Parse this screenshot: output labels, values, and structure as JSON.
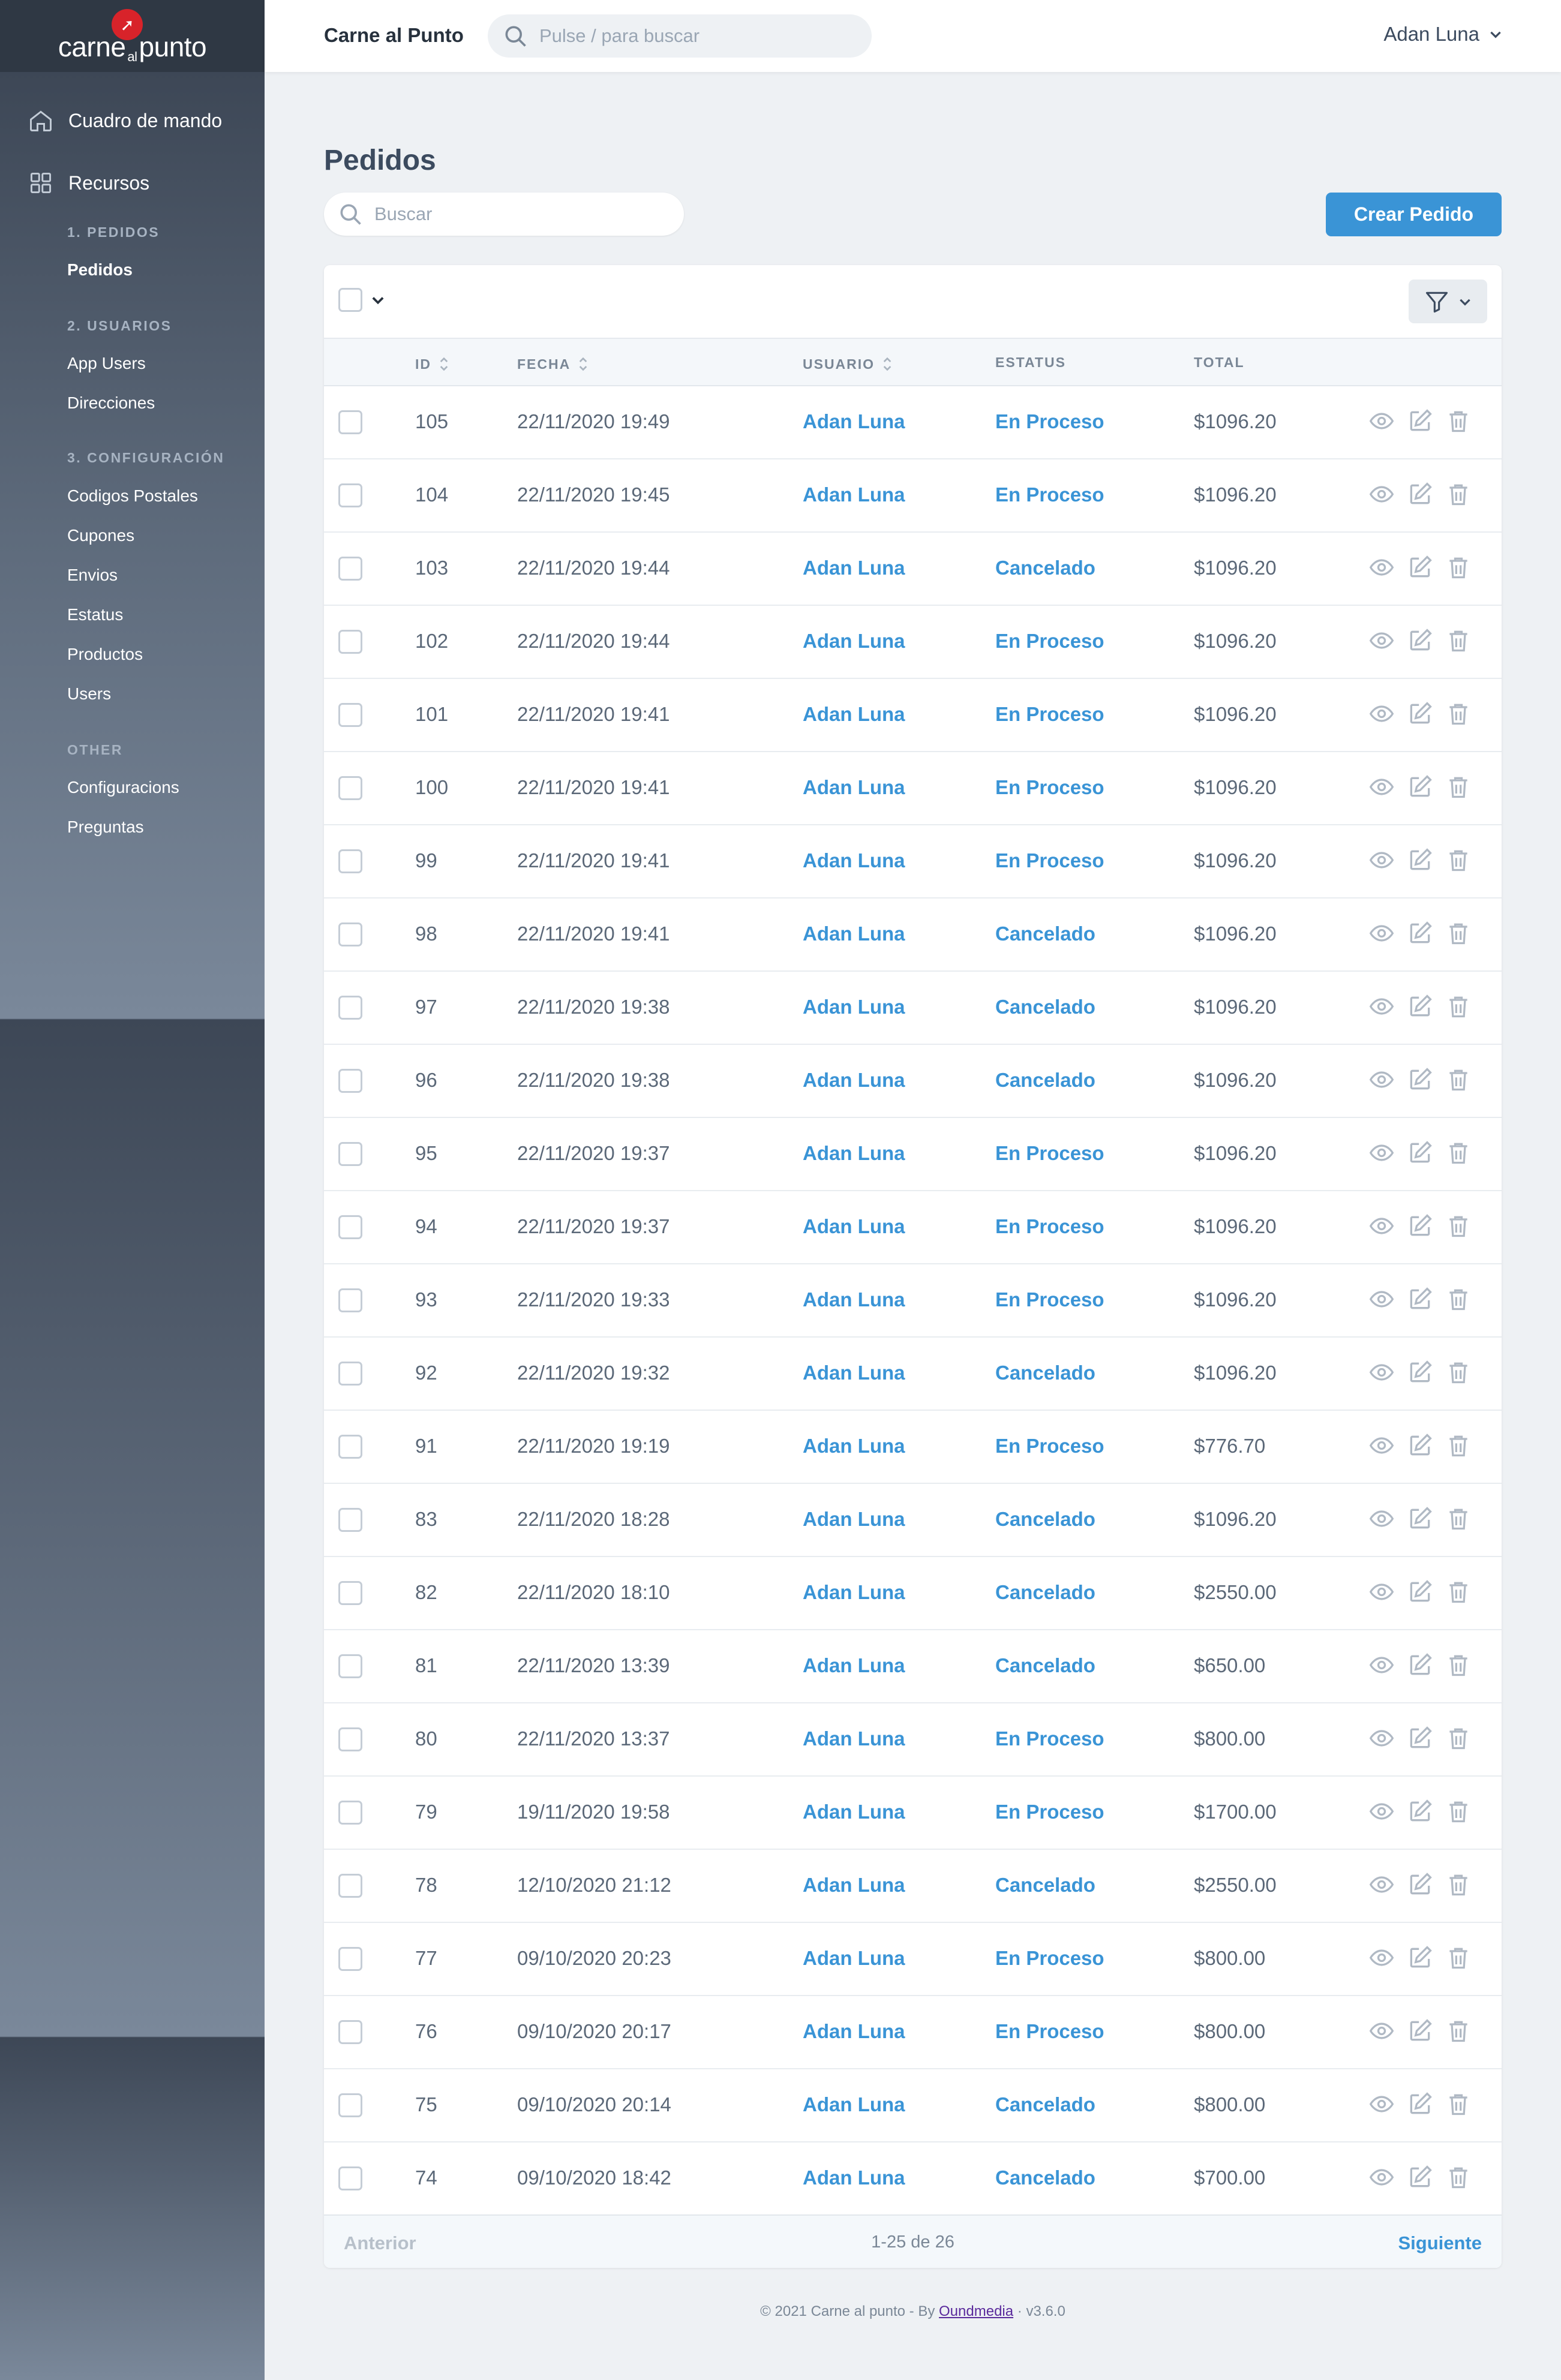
{
  "sidebar": {
    "logo": {
      "left": "carne",
      "middle": "al",
      "right": "punto"
    },
    "main_items": [
      {
        "label": "Cuadro de mando",
        "icon": "home-icon"
      },
      {
        "label": "Recursos",
        "icon": "grid-icon"
      }
    ],
    "sections": [
      {
        "title": "1. PEDIDOS",
        "items": [
          "Pedidos"
        ]
      },
      {
        "title": "2. USUARIOS",
        "items": [
          "App Users",
          "Direcciones"
        ]
      },
      {
        "title": "3. CONFIGURACIÓN",
        "items": [
          "Codigos Postales",
          "Cupones",
          "Envios",
          "Estatus",
          "Productos",
          "Users"
        ]
      },
      {
        "title": "OTHER",
        "items": [
          "Configuracions",
          "Preguntas"
        ]
      }
    ],
    "active_item": "Pedidos"
  },
  "header": {
    "brand": "Carne al Punto",
    "search_placeholder": "Pulse / para buscar",
    "user_name": "Adan Luna"
  },
  "main": {
    "title": "Pedidos",
    "search_placeholder": "Buscar",
    "create_button": "Crear Pedido"
  },
  "table": {
    "columns": [
      "ID",
      "FECHA",
      "USUARIO",
      "ESTATUS",
      "TOTAL"
    ],
    "rows": [
      {
        "id": "105",
        "fecha": "22/11/2020 19:49",
        "usuario": "Adan Luna",
        "estatus": "En Proceso",
        "total": "$1096.20"
      },
      {
        "id": "104",
        "fecha": "22/11/2020 19:45",
        "usuario": "Adan Luna",
        "estatus": "En Proceso",
        "total": "$1096.20"
      },
      {
        "id": "103",
        "fecha": "22/11/2020 19:44",
        "usuario": "Adan Luna",
        "estatus": "Cancelado",
        "total": "$1096.20"
      },
      {
        "id": "102",
        "fecha": "22/11/2020 19:44",
        "usuario": "Adan Luna",
        "estatus": "En Proceso",
        "total": "$1096.20"
      },
      {
        "id": "101",
        "fecha": "22/11/2020 19:41",
        "usuario": "Adan Luna",
        "estatus": "En Proceso",
        "total": "$1096.20"
      },
      {
        "id": "100",
        "fecha": "22/11/2020 19:41",
        "usuario": "Adan Luna",
        "estatus": "En Proceso",
        "total": "$1096.20"
      },
      {
        "id": "99",
        "fecha": "22/11/2020 19:41",
        "usuario": "Adan Luna",
        "estatus": "En Proceso",
        "total": "$1096.20"
      },
      {
        "id": "98",
        "fecha": "22/11/2020 19:41",
        "usuario": "Adan Luna",
        "estatus": "Cancelado",
        "total": "$1096.20"
      },
      {
        "id": "97",
        "fecha": "22/11/2020 19:38",
        "usuario": "Adan Luna",
        "estatus": "Cancelado",
        "total": "$1096.20"
      },
      {
        "id": "96",
        "fecha": "22/11/2020 19:38",
        "usuario": "Adan Luna",
        "estatus": "Cancelado",
        "total": "$1096.20"
      },
      {
        "id": "95",
        "fecha": "22/11/2020 19:37",
        "usuario": "Adan Luna",
        "estatus": "En Proceso",
        "total": "$1096.20"
      },
      {
        "id": "94",
        "fecha": "22/11/2020 19:37",
        "usuario": "Adan Luna",
        "estatus": "En Proceso",
        "total": "$1096.20"
      },
      {
        "id": "93",
        "fecha": "22/11/2020 19:33",
        "usuario": "Adan Luna",
        "estatus": "En Proceso",
        "total": "$1096.20"
      },
      {
        "id": "92",
        "fecha": "22/11/2020 19:32",
        "usuario": "Adan Luna",
        "estatus": "Cancelado",
        "total": "$1096.20"
      },
      {
        "id": "91",
        "fecha": "22/11/2020 19:19",
        "usuario": "Adan Luna",
        "estatus": "En Proceso",
        "total": "$776.70"
      },
      {
        "id": "83",
        "fecha": "22/11/2020 18:28",
        "usuario": "Adan Luna",
        "estatus": "Cancelado",
        "total": "$1096.20"
      },
      {
        "id": "82",
        "fecha": "22/11/2020 18:10",
        "usuario": "Adan Luna",
        "estatus": "Cancelado",
        "total": "$2550.00"
      },
      {
        "id": "81",
        "fecha": "22/11/2020 13:39",
        "usuario": "Adan Luna",
        "estatus": "Cancelado",
        "total": "$650.00"
      },
      {
        "id": "80",
        "fecha": "22/11/2020 13:37",
        "usuario": "Adan Luna",
        "estatus": "En Proceso",
        "total": "$800.00"
      },
      {
        "id": "79",
        "fecha": "19/11/2020 19:58",
        "usuario": "Adan Luna",
        "estatus": "En Proceso",
        "total": "$1700.00"
      },
      {
        "id": "78",
        "fecha": "12/10/2020 21:12",
        "usuario": "Adan Luna",
        "estatus": "Cancelado",
        "total": "$2550.00"
      },
      {
        "id": "77",
        "fecha": "09/10/2020 20:23",
        "usuario": "Adan Luna",
        "estatus": "En Proceso",
        "total": "$800.00"
      },
      {
        "id": "76",
        "fecha": "09/10/2020 20:17",
        "usuario": "Adan Luna",
        "estatus": "En Proceso",
        "total": "$800.00"
      },
      {
        "id": "75",
        "fecha": "09/10/2020 20:14",
        "usuario": "Adan Luna",
        "estatus": "Cancelado",
        "total": "$800.00"
      },
      {
        "id": "74",
        "fecha": "09/10/2020 18:42",
        "usuario": "Adan Luna",
        "estatus": "Cancelado",
        "total": "$700.00"
      }
    ],
    "row_actions": [
      "eye-icon",
      "edit-icon",
      "trash-icon"
    ]
  },
  "pagination": {
    "prev": "Anterior",
    "info": "1-25 de 26",
    "next": "Siguiente"
  },
  "footer": {
    "prefix": "© 2021 Carne al punto - By",
    "link": "Oundmedia",
    "version": "v3.6.0"
  },
  "colors": {
    "accent": "#3a94d6",
    "sidebar_top": "#2f3844",
    "logo_red": "#d8232a"
  }
}
